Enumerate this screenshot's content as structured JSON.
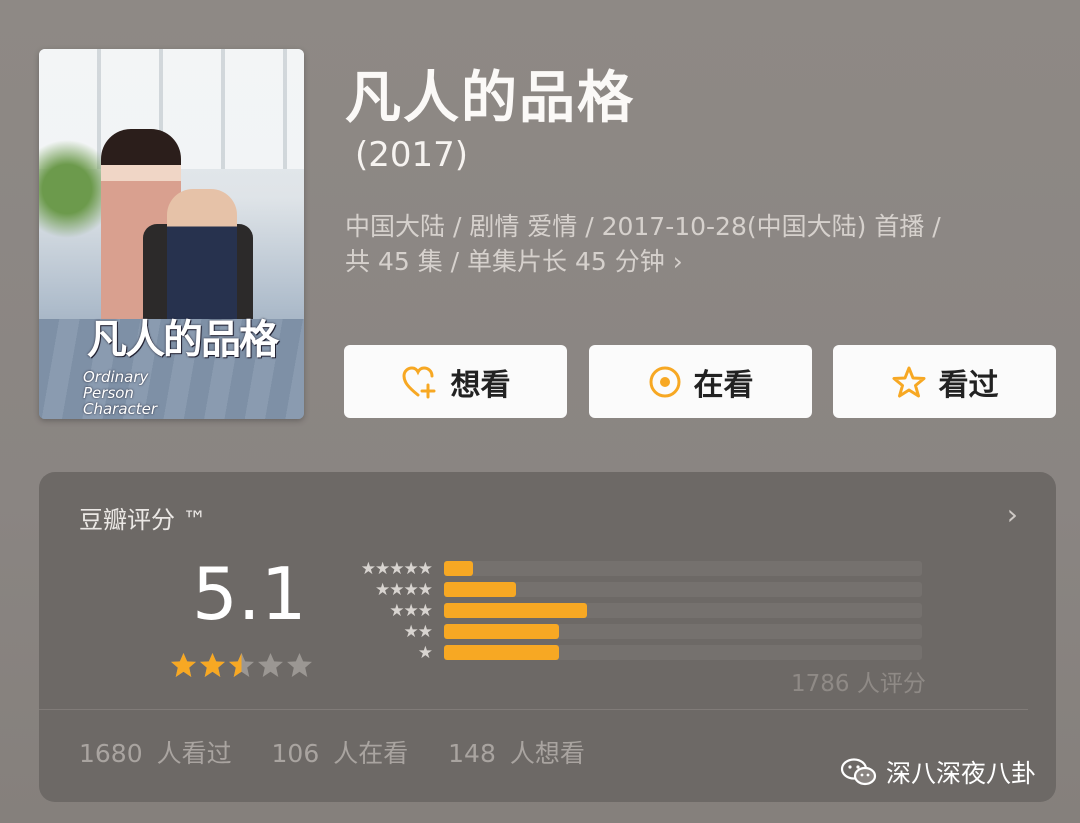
{
  "poster": {
    "title_art": "凡人的品格",
    "subtitle_art": "Ordinary Person Character"
  },
  "title": "凡人的品格",
  "year": "(2017)",
  "meta_line1": "中国大陆 / 剧情 爱情 / 2017-10-28(中国大陆) 首播 /",
  "meta_line2": "共 45 集 / 单集片长 45 分钟",
  "meta_chevron": "›",
  "actions": [
    {
      "label": "想看",
      "icon": "heart-plus-icon"
    },
    {
      "label": "在看",
      "icon": "target-circle-icon"
    },
    {
      "label": "看过",
      "icon": "star-outline-icon"
    }
  ],
  "rating": {
    "header": "豆瓣评分 ™",
    "chevron": "›",
    "score": "5.1",
    "star_level": 2.5,
    "distribution": [
      {
        "stars": "★★★★★",
        "fraction": 0.06
      },
      {
        "stars": "★★★★",
        "fraction": 0.15
      },
      {
        "stars": "★★★",
        "fraction": 0.3
      },
      {
        "stars": "★★",
        "fraction": 0.24
      },
      {
        "stars": "★",
        "fraction": 0.24
      }
    ],
    "count": "1786 人评分",
    "stats": [
      "1680 人看过",
      "106 人在看",
      "148 人想看"
    ]
  },
  "colors": {
    "accent": "#f7a823",
    "background": "#8a8582",
    "panel": "#6d6966"
  },
  "watermark": "深八深夜八卦"
}
